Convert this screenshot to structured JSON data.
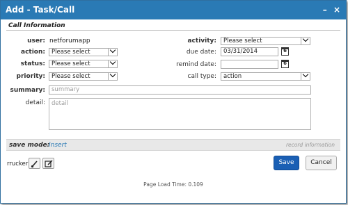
{
  "window": {
    "title": "Add - Task/Call",
    "minimize": "–",
    "close": "×"
  },
  "section": {
    "title": "Call Information"
  },
  "form": {
    "user": {
      "label": "user:",
      "value": "netforumapp"
    },
    "action": {
      "label": "action:",
      "value": "Please select"
    },
    "status": {
      "label": "status:",
      "value": "Please select"
    },
    "priority": {
      "label": "priority:",
      "value": "Please select"
    },
    "activity": {
      "label": "activity:",
      "value": "Please select"
    },
    "due_date": {
      "label": "due date:",
      "value": "03/31/2014"
    },
    "remind_date": {
      "label": "remind date:",
      "value": ""
    },
    "call_type": {
      "label": "call type:",
      "value": "action"
    },
    "summary": {
      "label": "summary:",
      "placeholder": "summary"
    },
    "detail": {
      "label": "detail:",
      "placeholder": "detail"
    },
    "calendar_digit": "6"
  },
  "savebar": {
    "label": "save mode:",
    "mode": "Insert",
    "record_info": "record information"
  },
  "bottom": {
    "user": "rrucker",
    "save": "Save",
    "cancel": "Cancel"
  },
  "footer": {
    "load_time": "Page Load Time: 0.109"
  },
  "colors": {
    "titlebar": "#2a7ab5",
    "save_button": "#1a5fb4",
    "link": "#2a7ab5"
  }
}
